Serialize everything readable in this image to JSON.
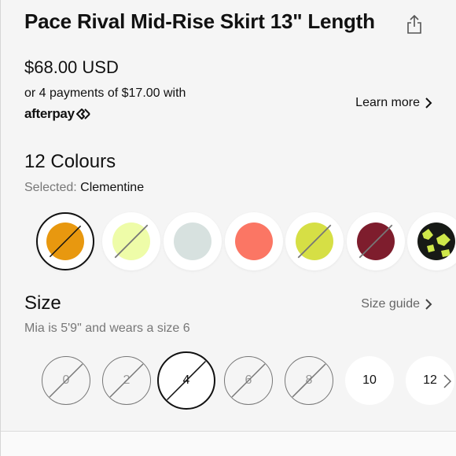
{
  "product": {
    "title": "Pace Rival Mid-Rise Skirt 13\" Length",
    "price": "$68.00 USD",
    "installments_text": "or 4 payments of $17.00 with",
    "afterpay_logo_text": "afterpay",
    "learn_more": "Learn more"
  },
  "colours": {
    "heading": "12 Colours",
    "selected_label": "Selected:",
    "selected_value": "Clementine",
    "swatches": [
      {
        "color": "#e8980f",
        "available": false,
        "selected": true
      },
      {
        "color": "#eefca8",
        "available": false,
        "selected": false
      },
      {
        "color": "#d7e1df",
        "available": true,
        "selected": false
      },
      {
        "color": "#fb7664",
        "available": true,
        "selected": false
      },
      {
        "color": "#d6df45",
        "available": false,
        "selected": false
      },
      {
        "color": "#7e1d2d",
        "available": false,
        "selected": false
      },
      {
        "color": "#171a16",
        "accent": "#cfe84a",
        "pattern": true,
        "available": true,
        "selected": false
      }
    ]
  },
  "size": {
    "heading": "Size",
    "guide": "Size guide",
    "model_info": "Mia is 5'9\" and wears a size 6",
    "options": [
      {
        "label": "0",
        "available": false,
        "selected": false
      },
      {
        "label": "2",
        "available": false,
        "selected": false
      },
      {
        "label": "4",
        "available": false,
        "selected": true
      },
      {
        "label": "6",
        "available": false,
        "selected": false
      },
      {
        "label": "8",
        "available": false,
        "selected": false
      },
      {
        "label": "10",
        "available": true,
        "selected": false
      },
      {
        "label": "12",
        "available": true,
        "selected": false
      }
    ]
  },
  "icons": {
    "share": "share-icon",
    "chevron": "chevron-right-icon",
    "afterpay_mark": "afterpay-arrows-icon"
  }
}
